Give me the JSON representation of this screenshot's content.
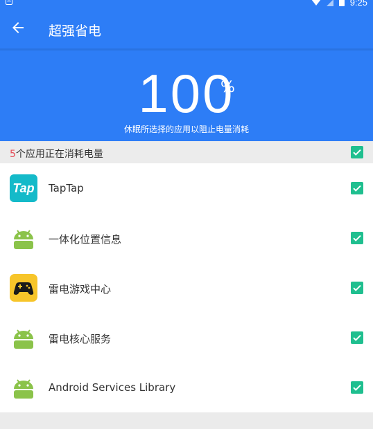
{
  "status_bar": {
    "left_icon": "A",
    "time": "9:25",
    "battery_glyph": "⚡"
  },
  "app_bar": {
    "title": "超强省电",
    "back_icon": "arrow-left"
  },
  "hero": {
    "percent": "100",
    "percent_sign": "%",
    "subtitle": "休眠所选择的应用以阻止电量消耗"
  },
  "section": {
    "count": "5",
    "label": "个应用正在消耗电量"
  },
  "apps": [
    {
      "name": "TapTap",
      "icon": "taptap-logo",
      "icon_text": "Tap"
    },
    {
      "name": "一体化位置信息",
      "icon": "android-robot"
    },
    {
      "name": "雷电游戏中心",
      "icon": "gamepad"
    },
    {
      "name": "雷电核心服务",
      "icon": "android-robot"
    },
    {
      "name": "Android Services Library",
      "icon": "android-robot"
    }
  ],
  "colors": {
    "primary": "#2d7df6",
    "check": "#1fbf8f",
    "count": "#e64a55",
    "android": "#8bc34a"
  }
}
